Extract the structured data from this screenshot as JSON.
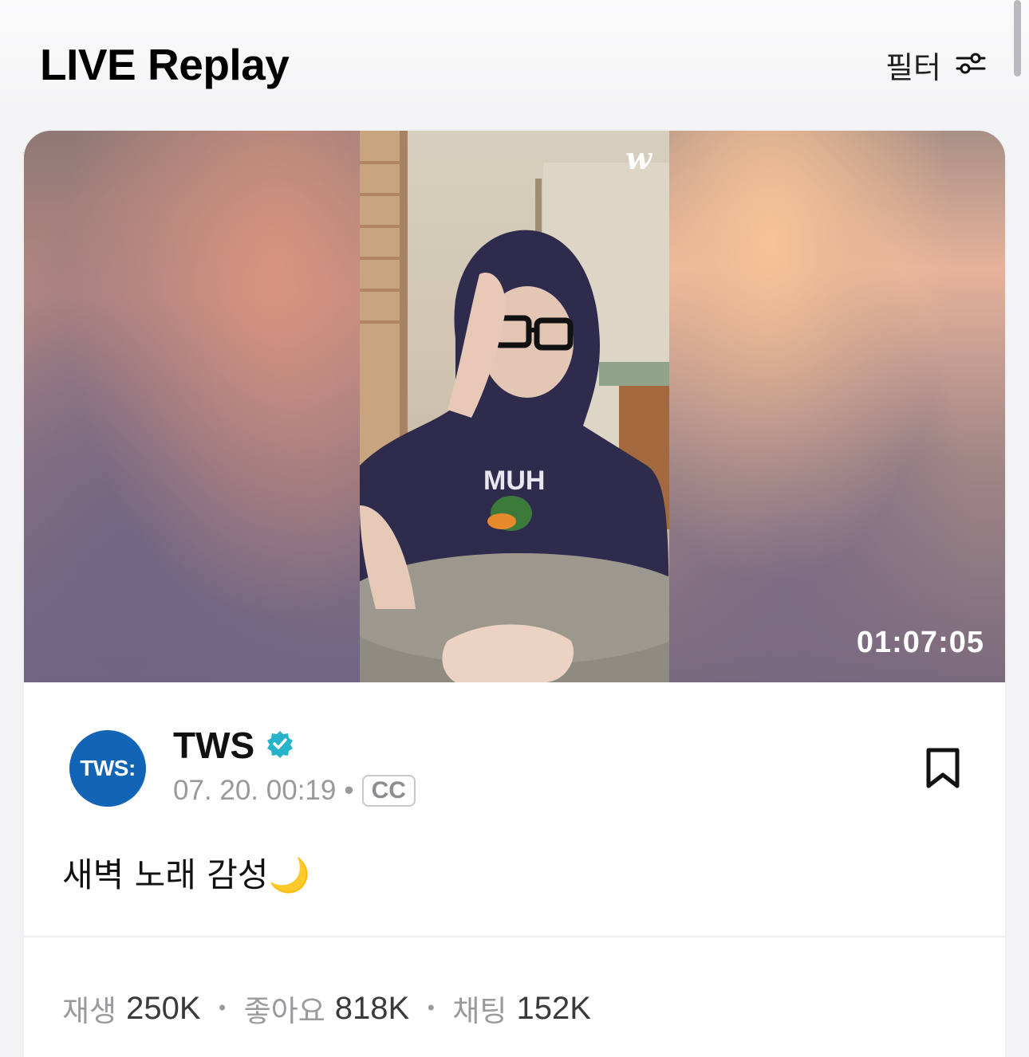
{
  "header": {
    "title": "LIVE Replay",
    "filter_label": "필터",
    "filter_icon": "sliders-icon"
  },
  "video": {
    "watermark": "w",
    "duration": "01:07:05"
  },
  "channel": {
    "avatar_text": "TWS:",
    "name": "TWS",
    "verified_icon": "verified-badge-icon",
    "date": "07. 20. 00:19",
    "separator": "•",
    "cc": "CC"
  },
  "post": {
    "title": "새벽 노래 감성🌙",
    "bookmark_icon": "bookmark-icon"
  },
  "stats": {
    "plays_label": "재생",
    "plays_value": "250K",
    "likes_label": "좋아요",
    "likes_value": "818K",
    "chats_label": "채팅",
    "chats_value": "152K",
    "separator": "•"
  },
  "colors": {
    "avatar_bg": "#1264b7",
    "verified": "#27b3c9"
  }
}
